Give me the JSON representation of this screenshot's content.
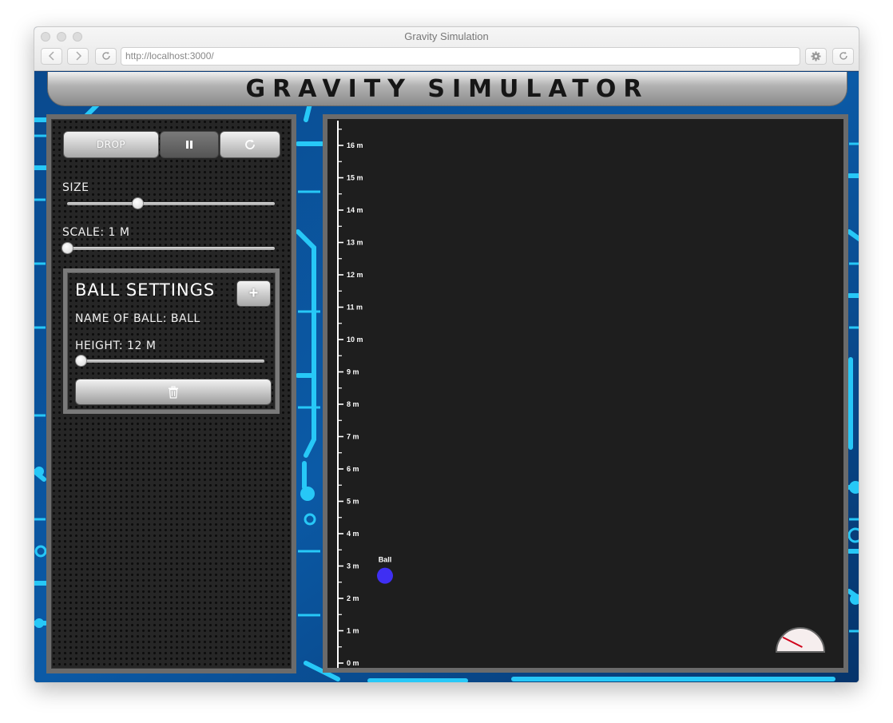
{
  "browser": {
    "window_title": "Gravity Simulation",
    "url": "http://localhost:3000/",
    "back_icon": "chevron-left-icon",
    "forward_icon": "chevron-right-icon",
    "reload_icon": "reload-icon",
    "settings_icon": "gear-icon"
  },
  "header": {
    "title": "GRAVITY SIMULATOR"
  },
  "controls": {
    "drop_label": "DROP",
    "pause_icon": "pause-icon",
    "reset_icon": "reset-icon",
    "size_label": "SIZE",
    "size_value": 0.34,
    "scale_label": "SCALE: 1 M",
    "scale_value": 0.0
  },
  "ball_settings": {
    "title": "BALL SETTINGS",
    "add_label": "+",
    "name_label": "NAME OF BALL:  BALL",
    "height_label": "HEIGHT: 12 M",
    "height_value": 0.0,
    "delete_icon": "trash-icon"
  },
  "simulation": {
    "ruler_labels": [
      "0 m",
      "1 m",
      "2 m",
      "3 m",
      "4 m",
      "5 m",
      "6 m",
      "7 m",
      "8 m",
      "9 m",
      "10 m",
      "11 m",
      "12 m",
      "13 m",
      "14 m",
      "15 m",
      "16 m"
    ],
    "ball": {
      "label": "Ball",
      "height_m": 2.7,
      "color": "#3f2ff3"
    },
    "gauge_needle_fraction": 0.2
  },
  "colors": {
    "circuit_light": "#1ec7f5",
    "circuit_dark": "#0b3d7a",
    "panel_border": "#6b6b6b"
  }
}
